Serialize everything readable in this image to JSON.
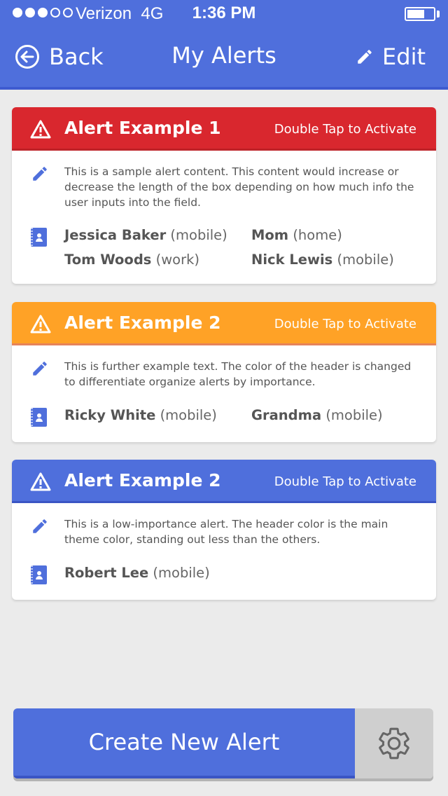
{
  "status_bar": {
    "carrier": "Verizon",
    "network": "4G",
    "time": "1:36 PM",
    "signal_strength": 3,
    "signal_max": 5,
    "battery_level": 0.7
  },
  "nav": {
    "back_label": "Back",
    "title": "My Alerts",
    "edit_label": "Edit"
  },
  "alerts": [
    {
      "title": "Alert Example 1",
      "action": "Double Tap to Activate",
      "color": "#d9272e",
      "description": "This is a sample alert content. This content would increase or decrease the length of the box depending on how much info the user inputs into the field.",
      "contacts": [
        {
          "name": "Jessica Baker",
          "type": "(mobile)"
        },
        {
          "name": "Mom",
          "type": "(home)"
        },
        {
          "name": "Tom Woods",
          "type": "(work)"
        },
        {
          "name": "Nick Lewis",
          "type": "(mobile)"
        }
      ]
    },
    {
      "title": "Alert Example 2",
      "action": "Double Tap to Activate",
      "color": "#ffa226",
      "description": "This is further example text. The color of the header is changed to differentiate organize alerts by importance.",
      "contacts": [
        {
          "name": "Ricky White",
          "type": "(mobile)"
        },
        {
          "name": "Grandma",
          "type": "(mobile)"
        }
      ]
    },
    {
      "title": "Alert Example 2",
      "action": "Double Tap to Activate",
      "color": "#4f6fdc",
      "description": "This is a low-importance alert. The header color is the main theme color, standing out less than the others.",
      "contacts": [
        {
          "name": "Robert Lee",
          "type": "(mobile)"
        }
      ]
    }
  ],
  "footer": {
    "create_label": "Create New Alert",
    "settings_icon": "gear-icon"
  },
  "colors": {
    "theme": "#4f6fdc",
    "background": "#ebebeb",
    "high": "#d9272e",
    "medium": "#ffa226"
  }
}
